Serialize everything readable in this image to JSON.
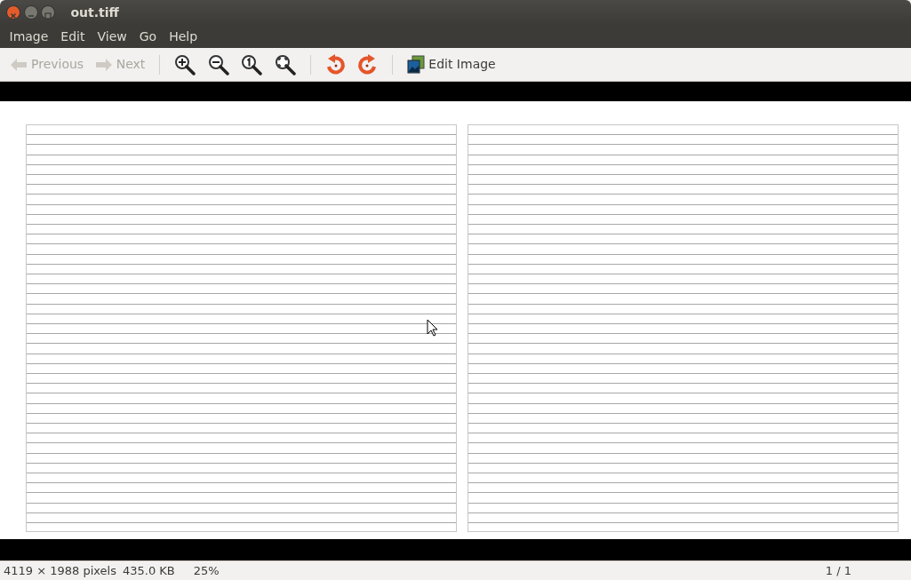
{
  "window": {
    "title": "out.tiff"
  },
  "menu": [
    "Image",
    "Edit",
    "View",
    "Go",
    "Help"
  ],
  "toolbar": [
    {
      "kind": "nav",
      "label": "Previous",
      "disabled": true
    },
    {
      "kind": "nav",
      "label": "Next",
      "disabled": true
    },
    {
      "kind": "sep"
    },
    {
      "kind": "icon",
      "disabled": false
    },
    {
      "kind": "icon",
      "disabled": false
    },
    {
      "kind": "icon",
      "disabled": false
    },
    {
      "kind": "icon",
      "disabled": false
    },
    {
      "kind": "sep"
    },
    {
      "kind": "icon",
      "disabled": false
    },
    {
      "kind": "icon",
      "disabled": false
    },
    {
      "kind": "sep"
    },
    {
      "kind": "nav",
      "label": "Edit Image",
      "disabled": false
    }
  ],
  "status_bar": {
    "dimensions": "4119 × 1988 pixels",
    "size": "435.0 KB",
    "zoom": "25%",
    "position": "1 / 1"
  }
}
